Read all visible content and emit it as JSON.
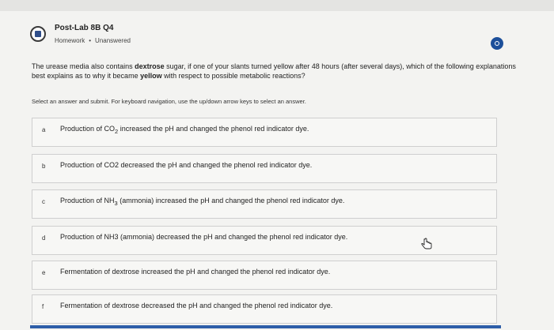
{
  "header": {
    "title": "Post-Lab 8B Q4",
    "type": "Homework",
    "separator": "•",
    "status": "Unanswered",
    "icon": "homework-icon"
  },
  "question": {
    "before": "The urease media also contains ",
    "bold1": "dextrose",
    "middle": " sugar, if one of your slants turned yellow after 48 hours (after several days), which of the following explanations best explains as to why it became ",
    "bold2": "yellow",
    "after": " with respect to possible metabolic reactions?"
  },
  "instructions": "Select an answer and submit. For keyboard navigation, use the up/down arrow keys to select an answer.",
  "options": [
    {
      "letter": "a",
      "pre": "Production of CO",
      "sub": "2",
      "post": " increased the pH and changed the phenol red indicator dye."
    },
    {
      "letter": "b",
      "pre": "Production of CO2 decreased the pH and changed the phenol red indicator dye.",
      "sub": "",
      "post": ""
    },
    {
      "letter": "c",
      "pre": "Production of NH",
      "sub": "3",
      "post": " (ammonia) increased the pH and changed the phenol red indicator dye."
    },
    {
      "letter": "d",
      "pre": "Production of NH3 (ammonia) decreased the pH and changed the phenol red indicator dye.",
      "sub": "",
      "post": ""
    },
    {
      "letter": "e",
      "pre": "Fermentation of dextrose increased the pH and changed the phenol red indicator dye.",
      "sub": "",
      "post": ""
    },
    {
      "letter": "f",
      "pre": "Fermentation of dextrose decreased the pH and changed the phenol red indicator dye.",
      "sub": "",
      "post": ""
    }
  ],
  "colors": {
    "accent": "#2e5ea8",
    "info_badge": "#1c4f9a"
  }
}
